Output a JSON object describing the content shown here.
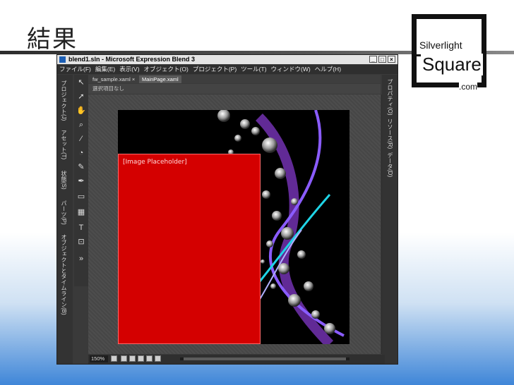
{
  "slide": {
    "title": "結果"
  },
  "logo": {
    "line1": "Silverlight",
    "line2": "Square",
    "line3": ".com"
  },
  "window": {
    "title": "blend1.sln - Microsoft Expression Blend 3",
    "controls": [
      "_",
      "□",
      "×"
    ],
    "menu": [
      "ファイル(F)",
      "編集(E)",
      "表示(V)",
      "オブジェクト(O)",
      "プロジェクト(P)",
      "ツール(T)",
      "ウィンドウ(W)",
      "ヘルプ(H)"
    ],
    "left_tabs": [
      "プロジェクト(J)",
      "アセット(T)",
      "状態(S)",
      "パーツ(P)",
      "オブジェクトとタイムライン(B)"
    ],
    "right_tabs": [
      "プロパティ(O)",
      "リソース(R)",
      "データ(D)"
    ],
    "doc_tabs": [
      {
        "label": "fw_sample.xaml ×",
        "active": false
      },
      {
        "label": "MainPage.xaml",
        "active": true
      }
    ],
    "breadcrumb": "選択項目なし",
    "placeholder": "[Image Placeholder]",
    "zoom": "150%"
  },
  "colors": {
    "placeholder_red": "#d40000",
    "app_bg": "#3a3a3a",
    "accent_blue": "#3f86d8"
  }
}
